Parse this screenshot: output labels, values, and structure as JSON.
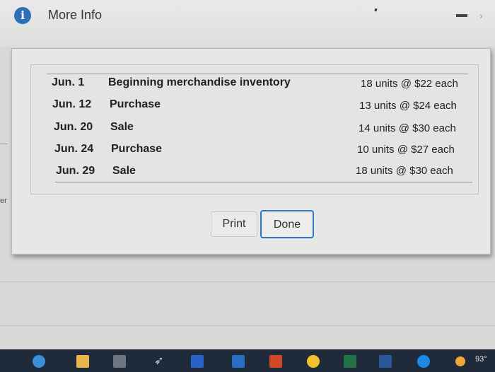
{
  "window": {
    "title": "More Info",
    "info_icon_glyph": "i",
    "minimize_icon": "minimize-icon",
    "close_icon_glyph": "›"
  },
  "table": {
    "rows": [
      {
        "date": "Jun. 1",
        "description": "Beginning merchandise inventory",
        "quantity": "18 units @ $22 each"
      },
      {
        "date": "Jun. 12",
        "description": "Purchase",
        "quantity": "13 units @ $24 each"
      },
      {
        "date": "Jun. 20",
        "description": "Sale",
        "quantity": "14 units @ $30 each"
      },
      {
        "date": "Jun. 24",
        "description": "Purchase",
        "quantity": "10 units @ $27 each"
      },
      {
        "date": "Jun. 29",
        "description": "Sale",
        "quantity": "18 units @ $30 each"
      }
    ]
  },
  "buttons": {
    "print_label": "Print",
    "done_label": "Done"
  },
  "background": {
    "side_text": "er"
  },
  "taskbar": {
    "temperature": "93°",
    "icons": [
      "start-icon",
      "file-explorer-icon",
      "calculator-icon",
      "arrow-icon",
      "dropbox-icon",
      "mail-icon",
      "office-icon",
      "chrome-icon",
      "excel-icon",
      "word-icon",
      "help-icon",
      "weather-icon"
    ]
  },
  "colors": {
    "accent": "#2f76c6",
    "info_icon": "#2f6fb6",
    "taskbar": "#1f2a3a"
  }
}
